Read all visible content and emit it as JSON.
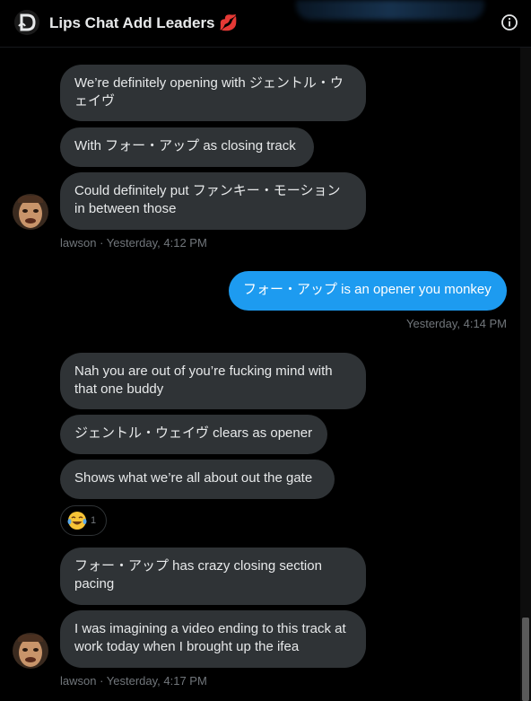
{
  "header": {
    "title": "Lips Chat Add Leaders 💋"
  },
  "messages": [
    {
      "text": "We’re definitely opening with ジェントル・ウェイヴ"
    },
    {
      "text": "With フォー・アップ as closing track"
    },
    {
      "text": "Could definitely put ファンキー・モーション in between those"
    },
    {
      "text": "フォー・アップ is an opener you monkey"
    },
    {
      "text": "Nah you are out of you’re fucking mind with that one buddy"
    },
    {
      "text": "ジェントル・ウェイヴ clears as opener"
    },
    {
      "text": "Shows what we’re all about out the gate"
    },
    {
      "text": "フォー・アップ has crazy closing section pacing"
    },
    {
      "text": "I was imagining a video ending to this track at work today when I brought up the ifea"
    }
  ],
  "meta": {
    "first": "lawson · Yesterday, 4:12 PM",
    "sent": "Yesterday, 4:14 PM",
    "last": "lawson · Yesterday, 4:17 PM"
  },
  "reaction": {
    "emoji_icon": "laughing-tears-icon",
    "count": "1"
  },
  "colors": {
    "background": "#000000",
    "bubble_received": "#2f3336",
    "bubble_sent": "#1d9bf0",
    "meta_text": "#71767b"
  }
}
